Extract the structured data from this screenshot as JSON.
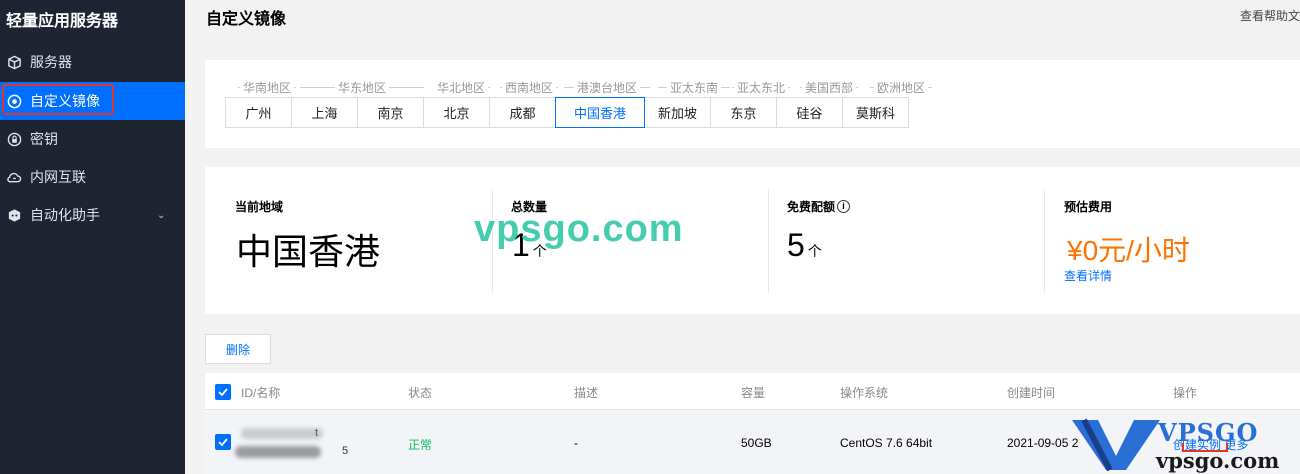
{
  "sidebar": {
    "title": "轻量应用服务器",
    "items": [
      {
        "label": "服务器",
        "icon": "cube-icon"
      },
      {
        "label": "自定义镜像",
        "icon": "target-icon",
        "active": true
      },
      {
        "label": "密钥",
        "icon": "lock-icon"
      },
      {
        "label": "内网互联",
        "icon": "cloud-link-icon"
      },
      {
        "label": "自动化助手",
        "icon": "robot-icon",
        "expandable": true
      }
    ]
  },
  "header": {
    "title": "自定义镜像",
    "help": "查看帮助文"
  },
  "regions": {
    "groups": [
      "华南地区",
      "华东地区",
      "华北地区",
      "西南地区",
      "港澳台地区",
      "亚太东南",
      "亚太东北",
      "美国西部",
      "欧洲地区"
    ],
    "tabs": [
      "广州",
      "上海",
      "南京",
      "北京",
      "成都",
      "中国香港",
      "新加坡",
      "东京",
      "硅谷",
      "莫斯科"
    ],
    "selected": "中国香港"
  },
  "stats": {
    "region_label": "当前地域",
    "region_value": "中国香港",
    "total_label": "总数量",
    "total_value": "1",
    "total_unit": "个",
    "quota_label": "免费配额",
    "quota_value": "5",
    "quota_unit": "个",
    "fee_label": "预估费用",
    "fee_value": "¥0元/小时",
    "fee_link": "查看详情"
  },
  "watermark": "vpsgo.com",
  "toolbar": {
    "delete_label": "删除"
  },
  "table": {
    "columns": [
      "ID/名称",
      "状态",
      "描述",
      "容量",
      "操作系统",
      "创建时间",
      "操作"
    ],
    "rows": [
      {
        "id_tail": "t",
        "name_tail": "5",
        "status": "正常",
        "description": "-",
        "capacity": "50GB",
        "os": "CentOS 7.6 64bit",
        "created": "2021-09-05 2",
        "action": "创建实例 更多"
      }
    ]
  },
  "logo": {
    "top": "VPSGO",
    "bottom": "vpsgo.com"
  },
  "colors": {
    "accent": "#006eff",
    "sidebar_bg": "#1f2433",
    "fee": "#ff7200",
    "status_ok": "#0abf5b",
    "watermark": "#33c7a6"
  }
}
